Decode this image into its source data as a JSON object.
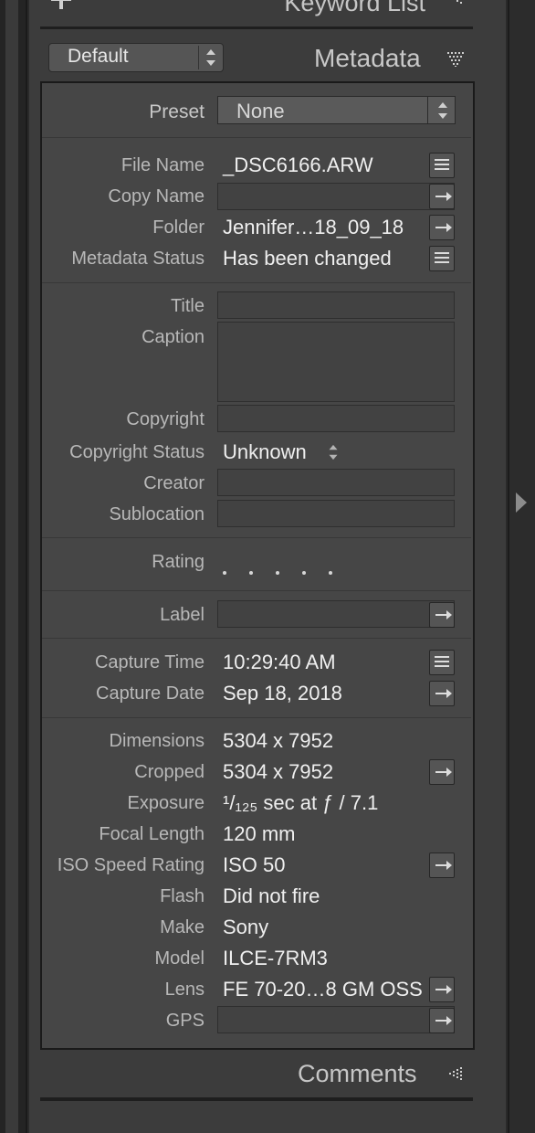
{
  "top_panel": {
    "add_label": "",
    "title": "Keyword List"
  },
  "metadata": {
    "preset_menu_value": "Default",
    "title": "Metadata",
    "preset_label": "Preset",
    "preset_value": "None"
  },
  "file": {
    "file_name_label": "File Name",
    "file_name_value": "_DSC6166.ARW",
    "copy_name_label": "Copy Name",
    "copy_name_value": "",
    "folder_label": "Folder",
    "folder_value": "Jennifer…18_09_18",
    "status_label": "Metadata Status",
    "status_value": "Has been changed"
  },
  "iptc": {
    "title_label": "Title",
    "caption_label": "Caption",
    "copyright_label": "Copyright",
    "copyright_status_label": "Copyright Status",
    "copyright_status_value": "Unknown",
    "creator_label": "Creator",
    "sublocation_label": "Sublocation"
  },
  "rating": {
    "label": "Rating",
    "stars": 0,
    "max": 5
  },
  "label_field": {
    "label": "Label",
    "value": ""
  },
  "capture": {
    "time_label": "Capture Time",
    "time_value": "10:29:40 AM",
    "date_label": "Capture Date",
    "date_value": "Sep 18, 2018"
  },
  "exif": {
    "dimensions_label": "Dimensions",
    "dimensions_value": "5304 x 7952",
    "cropped_label": "Cropped",
    "cropped_value": "5304 x 7952",
    "exposure_label": "Exposure",
    "exposure_value": "¹/₁₂₅ sec at ƒ / 7.1",
    "focal_label": "Focal Length",
    "focal_value": "120 mm",
    "iso_label": "ISO Speed Rating",
    "iso_value": "ISO 50",
    "flash_label": "Flash",
    "flash_value": "Did not fire",
    "make_label": "Make",
    "make_value": "Sony",
    "model_label": "Model",
    "model_value": "ILCE-7RM3",
    "lens_label": "Lens",
    "lens_value": "FE 70-20…8 GM OSS",
    "gps_label": "GPS",
    "gps_value": ""
  },
  "comments": {
    "title": "Comments"
  }
}
